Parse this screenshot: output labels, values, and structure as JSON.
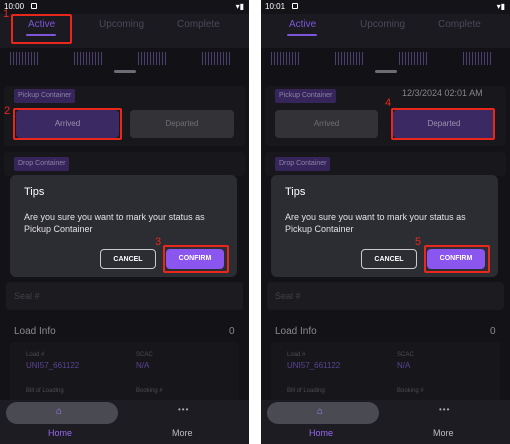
{
  "left_phone": {
    "status": {
      "time": "10:00"
    },
    "tabs": [
      "Active",
      "Upcoming",
      "Complete"
    ],
    "pickup_label": "Pickup Container",
    "arrived_label": "Arrived",
    "departed_label": "Departed",
    "drop_label": "Drop Container",
    "seal_label": "Seal #",
    "dialog": {
      "title": "Tips",
      "message": "Are you sure  you want to mark your status as Pickup Container",
      "cancel": "CANCEL",
      "confirm": "CONFIRM"
    },
    "load_info": {
      "title": "Load Info",
      "count": "0"
    },
    "card": {
      "load_label": "Load #",
      "load_value": "UNI57_661122",
      "scac_label": "SCAC",
      "scac_value": "N/A",
      "bol_label": "Bill of Loading",
      "booking_label": "Booking #"
    },
    "nav": {
      "home": "Home",
      "more": "More"
    },
    "annotations": [
      "1",
      "2",
      "3"
    ]
  },
  "right_phone": {
    "status": {
      "time": "10:01"
    },
    "tabs": [
      "Active",
      "Upcoming",
      "Complete"
    ],
    "pickup_label": "Pickup Container",
    "timestamp": "12/3/2024 02:01 AM",
    "arrived_label": "Arrived",
    "departed_label": "Departed",
    "drop_label": "Drop Container",
    "seal_label": "Seal #",
    "dialog": {
      "title": "Tips",
      "message": "Are you sure  you want to mark your status as Pickup Container",
      "cancel": "CANCEL",
      "confirm": "CONFIRM"
    },
    "load_info": {
      "title": "Load Info",
      "count": "0"
    },
    "card": {
      "load_label": "Load #",
      "load_value": "UNI57_661122",
      "scac_label": "SCAC",
      "scac_value": "N/A",
      "bol_label": "Bill of Loading",
      "booking_label": "Booking #"
    },
    "nav": {
      "home": "Home",
      "more": "More"
    },
    "annotations": [
      "4",
      "5"
    ]
  },
  "icons": {
    "home": "home-icon",
    "more": "more-dots-icon",
    "wifi": "wifi-icon",
    "battery": "battery-icon",
    "sim": "sim-icon"
  },
  "colors": {
    "accent": "#8b55f0",
    "tag_bg": "#4c3681",
    "annotation_red": "#e8271d",
    "background": "#1b1b21"
  }
}
